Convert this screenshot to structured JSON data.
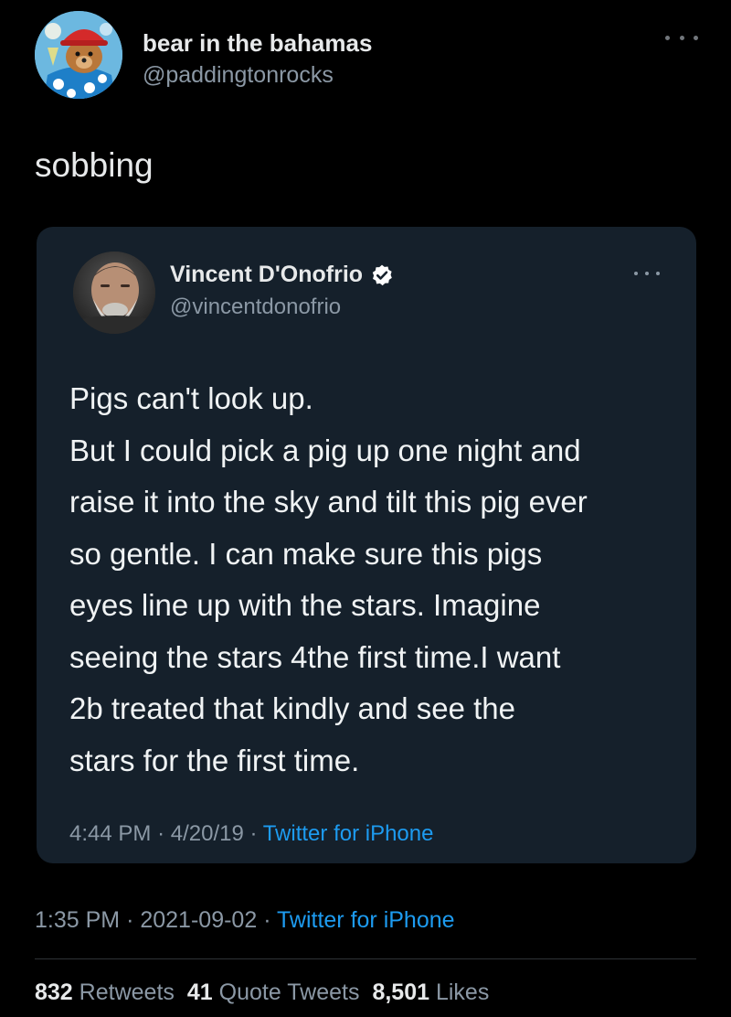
{
  "tweet": {
    "author": {
      "name": "bear in the bahamas",
      "handle": "@paddingtonrocks",
      "avatar_icon": "bear-avatar-icon"
    },
    "text": "sobbing",
    "time": "1:35 PM",
    "date": "2021-09-02",
    "source": "Twitter for iPhone",
    "stats": {
      "retweets_count": "832",
      "retweets_label": "Retweets",
      "quotes_count": "41",
      "quotes_label": "Quote Tweets",
      "likes_count": "8,501",
      "likes_label": "Likes"
    }
  },
  "quoted_tweet": {
    "author": {
      "name": "Vincent D'Onofrio",
      "handle": "@vincentdonofrio",
      "verified": true,
      "avatar_icon": "portrait-avatar-icon"
    },
    "lines": [
      "Pigs can't look up.",
      "But I could pick a pig up one night and",
      "raise it into the sky and tilt this pig ever",
      "so gentle. I can make sure this pigs",
      "eyes line up with the stars. Imagine",
      "seeing the stars 4the first time.I want",
      "2b treated that kindly and see the",
      "stars for the first time."
    ],
    "time": "4:44 PM",
    "date": "4/20/19",
    "source": "Twitter for iPhone"
  },
  "separator": "·",
  "colors": {
    "background": "#000000",
    "card": "#15202b",
    "link": "#1d9bf0",
    "secondary_text": "#8b98a5",
    "primary_text": "#e7e9ea"
  }
}
